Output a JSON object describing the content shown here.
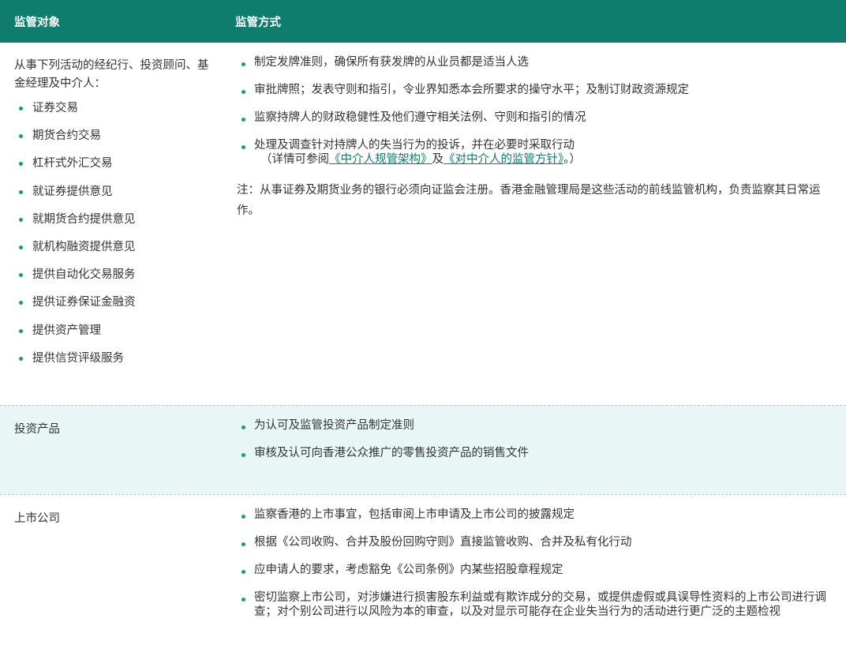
{
  "header": {
    "col1": "监管对象",
    "col2": "监管方式"
  },
  "rows": [
    {
      "subject_intro": "从事下列活动的经纪行、投资顾问、基金经理及中介人：",
      "subject_items": [
        "证券交易",
        "期货合约交易",
        "杠杆式外汇交易",
        "就证券提供意见",
        "就期货合约提供意见",
        "就机构融资提供意见",
        "提供自动化交易服务",
        "提供证券保证金融资",
        "提供资产管理",
        "提供信贷评级服务"
      ],
      "methods": [
        "制定发牌准则，确保所有获发牌的从业员都是适当人选",
        "审批牌照；发表守则和指引，令业界知悉本会所要求的操守水平；及制订财政资源规定",
        "监察持牌人的财政稳健性及他们遵守相关法例、守则和指引的情况",
        "处理及调查针对持牌人的失当行为的投诉，并在必要时采取行动"
      ],
      "cite_prefix": "（详情可参阅",
      "link1": "《中介人规管架构》",
      "cite_and": "及",
      "link2": "《对中介人的监管方针》",
      "cite_suffix": "。）",
      "note": "注：从事证券及期货业务的银行必须向证监会注册。香港金融管理局是这些活动的前线监管机构，负责监察其日常运作。"
    },
    {
      "subject": "投资产品",
      "methods": [
        "为认可及监管投资产品制定准则",
        "审核及认可向香港公众推广的零售投资产品的销售文件"
      ]
    },
    {
      "subject": "上市公司",
      "methods": [
        "监察香港的上市事宜，包括审阅上市申请及上市公司的披露规定",
        "根据《公司收购、合并及股份回购守则》直接监管收购、合并及私有化行动",
        "应申请人的要求，考虑豁免《公司条例》内某些招股章程规定",
        "密切监察上市公司，对涉嫌进行损害股东利益或有欺诈成分的交易，或提供虚假或具误导性资料的上市公司进行调查；对个别公司进行以风险为本的审查，以及对显示可能存在企业失当行为的活动进行更广泛的主题检视"
      ]
    }
  ]
}
